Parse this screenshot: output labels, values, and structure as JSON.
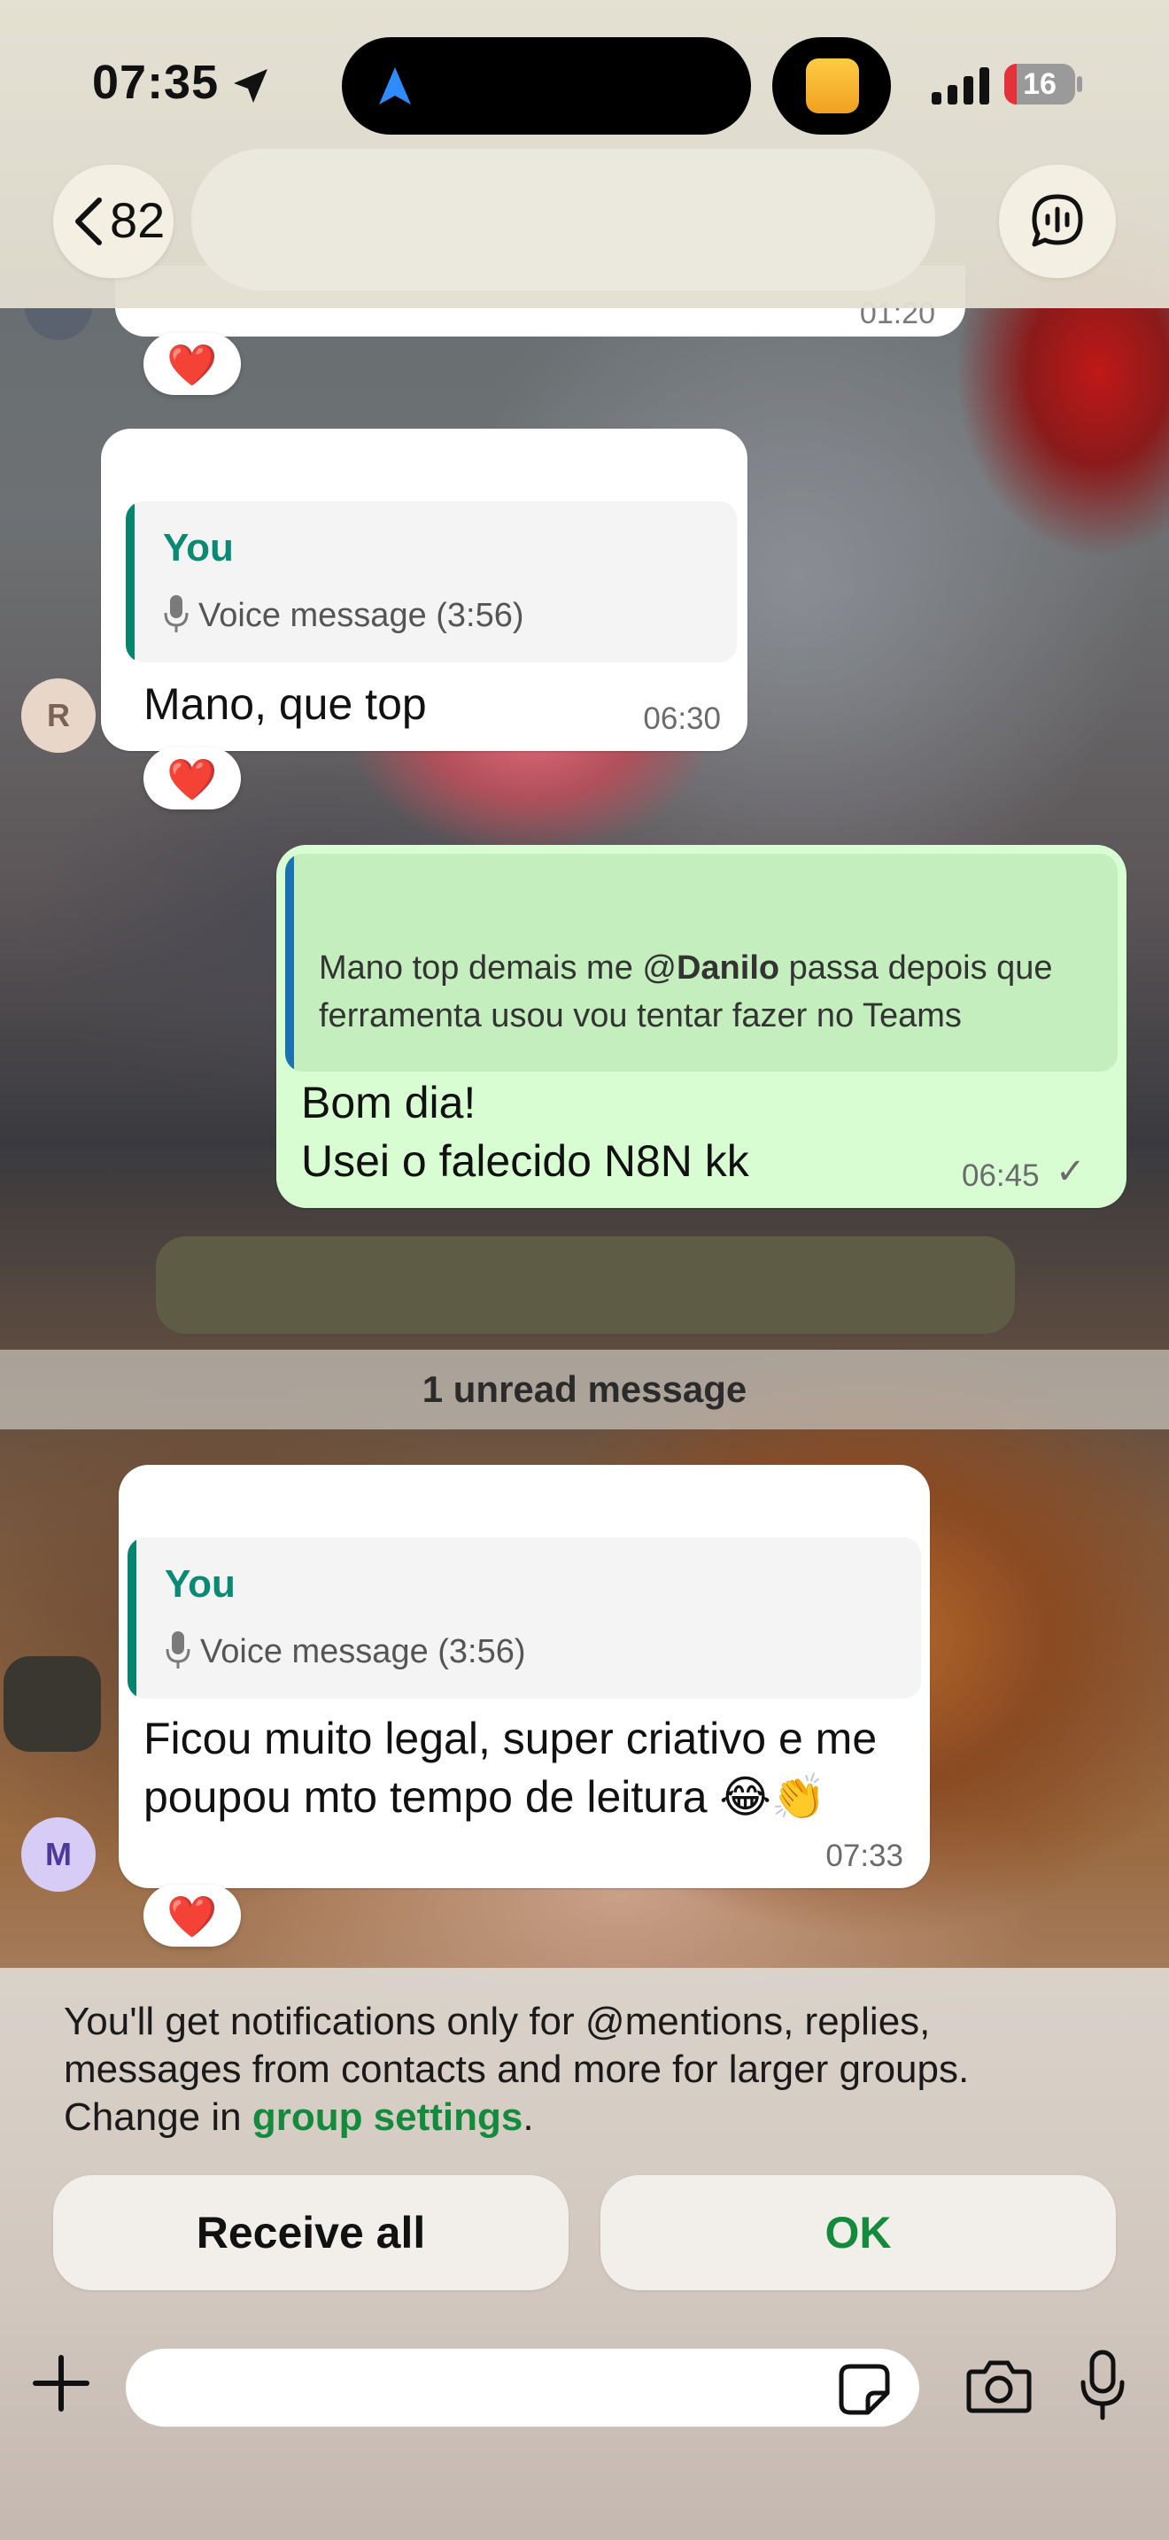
{
  "status_bar": {
    "time": "07:35",
    "battery": "16"
  },
  "header": {
    "back_count": "82"
  },
  "messages": [
    {
      "reaction": "❤️",
      "quote_name": "You",
      "quote_text": "Voice message (3:56)",
      "text": "Mano, que top",
      "time": "06:30",
      "avatar": "R",
      "avatar_bg": "#e8d6c9"
    },
    {
      "quote_pre": "Mano top demais me @",
      "quote_mention": "Danilo",
      "quote_post": " passa depois que ferramenta usou vou tentar fazer no Teams",
      "line1": "Bom dia!",
      "line2": "Usei o falecido N8N kk",
      "time": "06:45",
      "check": "✓"
    },
    {
      "reaction": "❤️",
      "quote_name": "You",
      "quote_text": "Voice message (3:56)",
      "line1": "Ficou muito legal, super criativo e me",
      "line2": "poupou mto tempo de leitura 😂👏",
      "time": "07:33",
      "avatar": "M",
      "avatar_bg": "#d7ccf5"
    }
  ],
  "top_reaction": "❤️",
  "top_time_partial": "01:20",
  "unread_label": "1 unread message",
  "notice": {
    "text": "You'll get notifications only for @mentions, replies, messages from contacts and more for larger groups. Change in ",
    "link": "group settings",
    "end": "."
  },
  "buttons": {
    "receive_all": "Receive all",
    "ok": "OK"
  },
  "colors": {
    "accent_green": "#138a3c",
    "outgoing_bubble": "#d9fdd3",
    "quote_bar": "#06846f"
  }
}
